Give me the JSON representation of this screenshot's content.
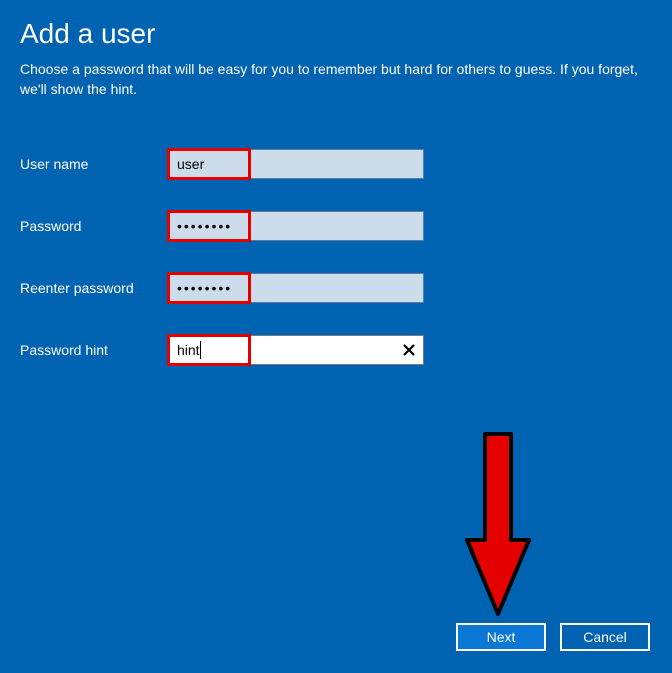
{
  "header": {
    "title": "Add a user",
    "subtitle": "Choose a password that will be easy for you to remember but hard for others to guess. If you forget, we'll show the hint."
  },
  "form": {
    "username_label": "User name",
    "username_value": "user",
    "password_label": "Password",
    "password_value": "••••••••",
    "reenter_label": "Reenter password",
    "reenter_value": "••••••••",
    "hint_label": "Password hint",
    "hint_value": "hint"
  },
  "buttons": {
    "next": "Next",
    "cancel": "Cancel"
  },
  "annotation": {
    "arrow_color": "#e50000",
    "highlight_color": "#e50000"
  }
}
